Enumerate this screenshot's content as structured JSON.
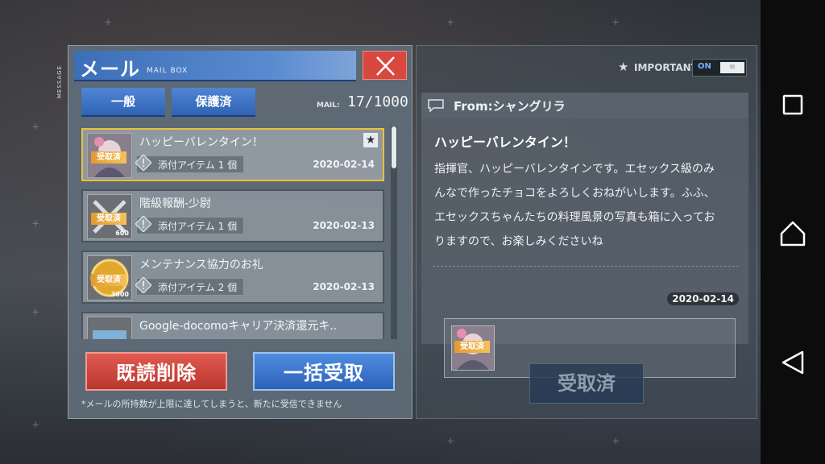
{
  "mail_panel": {
    "side_label": "MESSAGE",
    "title": "メール",
    "subtitle": "MAIL BOX",
    "tabs": [
      {
        "label": "一般"
      },
      {
        "label": "保護済"
      }
    ],
    "mail_count_label": "MAIL:",
    "mail_count": "17/1000",
    "items": [
      {
        "subject": "ハッピーバレンタイン！",
        "attach": "添付アイテム 1 個",
        "date": "2020-02-14",
        "status": "受取済",
        "thumb_num": ""
      },
      {
        "subject": "階級報酬-少尉",
        "attach": "添付アイテム 1 個",
        "date": "2020-02-13",
        "status": "受取済",
        "thumb_num": "600"
      },
      {
        "subject": "メンテナンス協力のお礼",
        "attach": "添付アイテム 2 個",
        "date": "2020-02-13",
        "status": "受取済",
        "thumb_num": "3000"
      },
      {
        "subject": "Google-docomoキャリア決済還元キ..",
        "attach": "",
        "date": "",
        "status": "",
        "thumb_num": ""
      }
    ],
    "delete_read_label": "既読削除",
    "claim_all_label": "一括受取",
    "notice": "*メールの所持数が上限に達してしまうと、新たに受信できません"
  },
  "detail_panel": {
    "important_label": "IMPORTANT",
    "toggle_label": "ON",
    "from": "From:シャングリラ",
    "title": "ハッピーバレンタイン！",
    "body_lines": [
      "指揮官、ハッピーバレンタインです。エセックス級のみ",
      "んなで作ったチョコをよろしくおねがいします。ふふ、",
      "エセックスちゃんたちの料理風景の写真も箱に入ってお",
      "りますので、お楽しみくださいね"
    ],
    "date": "2020-02-14",
    "attachment_status": "受取済",
    "claimed_button": "受取済"
  },
  "colors": {
    "accent_blue": "#3c6fb8",
    "close_red": "#d8483f",
    "selected_border": "#e8c23a",
    "claimed_tag": "#f4c15a"
  }
}
